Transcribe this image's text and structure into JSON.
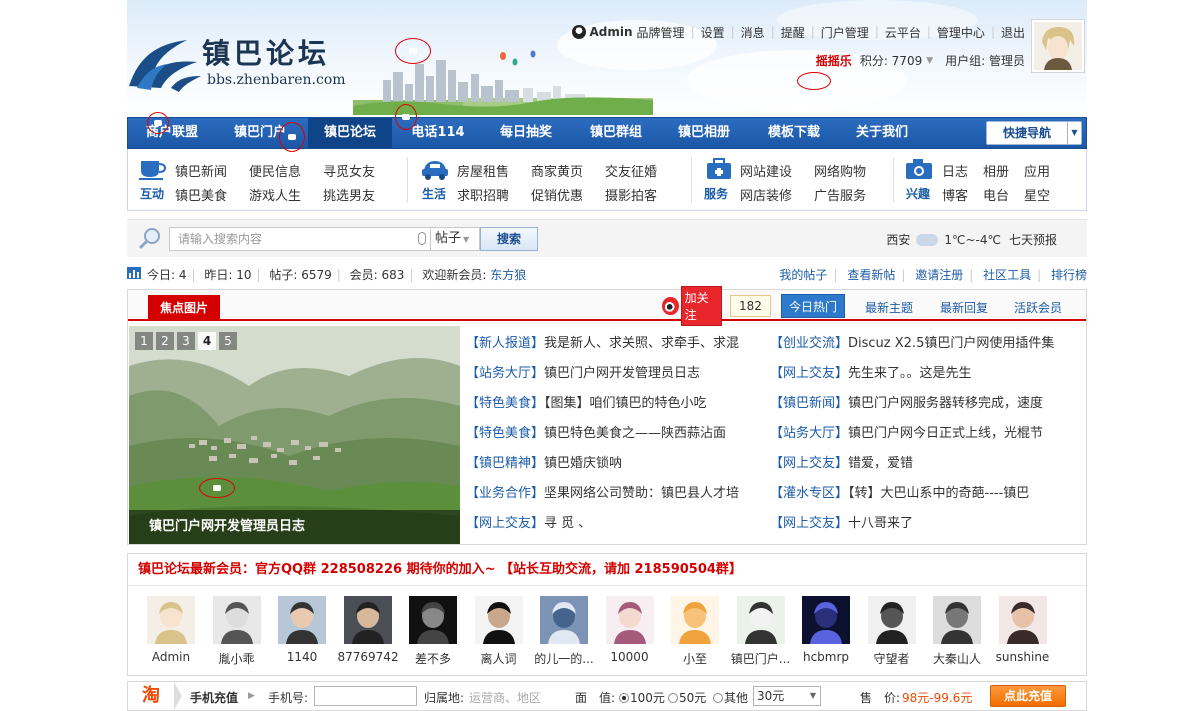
{
  "header": {
    "logo_cn": "镇巴论坛",
    "logo_en": "bbs.zhenbaren.com",
    "username": "Admin",
    "top_links": [
      "品牌管理",
      "设置",
      "消息",
      "提醒",
      "门户管理",
      "云平台",
      "管理中心",
      "退出"
    ],
    "shake_label": "摇摇乐",
    "points_label": "积分: 7709",
    "usergroup_label": "用户组: 管理员"
  },
  "nav": {
    "items": [
      "商户联盟",
      "镇巴门户",
      "镇巴论坛",
      "电话114",
      "每日抽奖",
      "镇巴群组",
      "镇巴相册",
      "模板下载",
      "关于我们"
    ],
    "active_index": 2,
    "quick_nav": "快捷导航"
  },
  "subnav": {
    "groups": [
      {
        "label": "互动",
        "icon": "cup-icon",
        "links": [
          "镇巴新闻",
          "便民信息",
          "寻觅女友",
          "镇巴美食",
          "游戏人生",
          "挑选男友"
        ]
      },
      {
        "label": "生活",
        "icon": "car-icon",
        "links": [
          "房屋租售",
          "商家黄页",
          "交友征婚",
          "求职招聘",
          "促销优惠",
          "摄影拍客"
        ]
      },
      {
        "label": "服务",
        "icon": "briefcase-icon",
        "links": [
          "网站建设",
          "网络购物",
          "网店装修",
          "广告服务"
        ]
      },
      {
        "label": "兴趣",
        "icon": "camera-icon",
        "links": [
          "日志",
          "相册",
          "应用",
          "博客",
          "电台",
          "星空"
        ]
      }
    ]
  },
  "search": {
    "placeholder": "请输入搜索内容",
    "type": "帖子",
    "button": "搜索"
  },
  "weather": {
    "city": "西安",
    "temp": "1℃~-4℃",
    "forecast": "七天预报"
  },
  "stats": {
    "today": "今日: 4",
    "yesterday": "昨日: 10",
    "posts": "帖子: 6579",
    "members": "会员: 683",
    "welcome": "欢迎新会员:",
    "newest_member": "东方狼",
    "links": [
      "我的帖子",
      "查看新帖",
      "邀请注册",
      "社区工具",
      "排行榜"
    ]
  },
  "focus": {
    "tab": "焦点图片",
    "follow": "加关注",
    "follow_count": "182",
    "tabs": [
      "今日热门",
      "最新主题",
      "最新回复",
      "活跃会员"
    ],
    "slide_numbers": [
      "1",
      "2",
      "3",
      "4",
      "5"
    ],
    "slide_active": "4",
    "slide_caption": "镇巴门户网开发管理员日志",
    "threads_left": [
      {
        "cat": "【新人报道】",
        "title": "我是新人、求关照、求牵手、求混"
      },
      {
        "cat": "【站务大厅】",
        "title": "镇巴门户网开发管理员日志"
      },
      {
        "cat": "【特色美食】",
        "title": "【图集】咱们镇巴的特色小吃"
      },
      {
        "cat": "【特色美食】",
        "title": "镇巴特色美食之——陕西蒜沾面"
      },
      {
        "cat": "【镇巴精神】",
        "title": "镇巴婚庆锁呐"
      },
      {
        "cat": "【业务合作】",
        "title": "坚果网络公司赞助：镇巴县人才培"
      },
      {
        "cat": "【网上交友】",
        "title": "寻 觅 、"
      }
    ],
    "threads_right": [
      {
        "cat": "【创业交流】",
        "title": "Discuz X2.5镇巴门户网使用插件集"
      },
      {
        "cat": "【网上交友】",
        "title": "先生来了。。这是先生"
      },
      {
        "cat": "【镇巴新闻】",
        "title": "镇巴门户网服务器转移完成，速度"
      },
      {
        "cat": "【站务大厅】",
        "title": "镇巴门户网今日正式上线，光棍节"
      },
      {
        "cat": "【网上交友】",
        "title": "错爱，爱错"
      },
      {
        "cat": "【灌水专区】",
        "title": "【转】大巴山系中的奇葩----镇巴"
      },
      {
        "cat": "【网上交友】",
        "title": "十八哥来了"
      }
    ]
  },
  "members": {
    "title": "镇巴论坛最新会员：官方QQ群 228508226 期待你的加入~ 【站长互助交流，请加 218590504群】",
    "list": [
      "Admin",
      "胤小乖",
      "1140",
      "87769742",
      "差不多",
      "离人词",
      "的儿一的...",
      "10000",
      "小至",
      "镇巴门户...",
      "hcbmrp",
      "守望者",
      "大秦山人",
      "sunshine"
    ]
  },
  "recharge": {
    "tao": "淘",
    "title": "手机充值",
    "phone_label": "手机号:",
    "region_label": "归属地:",
    "region_value": "运营商、地区",
    "face_label": "面　值:",
    "opt1": "100元",
    "opt2": "50元",
    "opt3": "其他",
    "select_value": "30元",
    "sale_label": "售　价:",
    "price": "98元-99.6元",
    "button": "点此充值"
  },
  "colors": {
    "nav_blue": "#1f5fae",
    "accent_red": "#d40000",
    "link_blue": "#1c5ca8",
    "orange": "#f06d00"
  }
}
